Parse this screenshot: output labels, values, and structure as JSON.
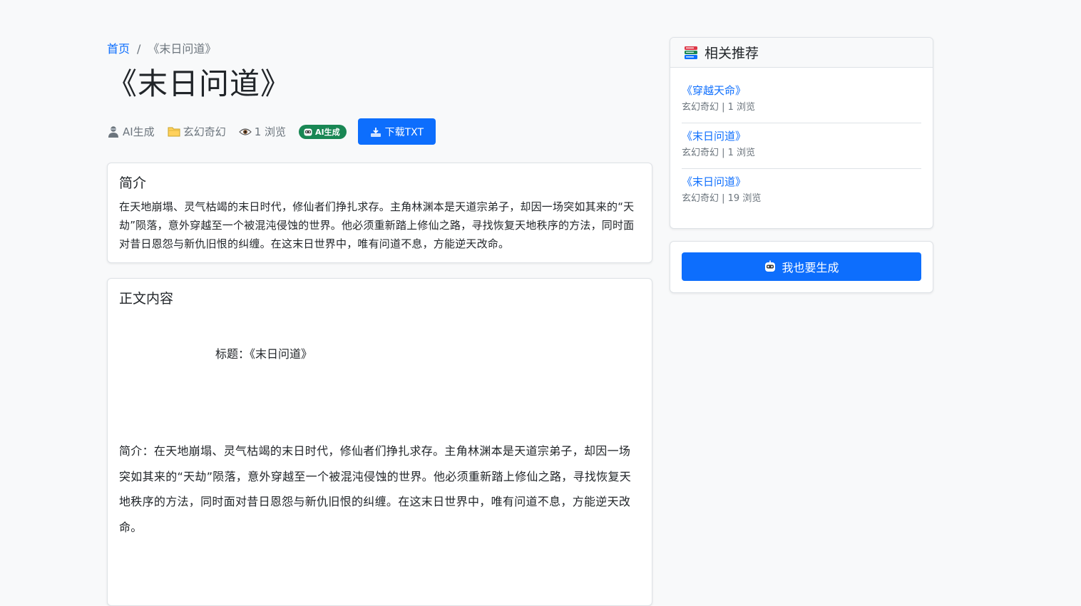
{
  "breadcrumb": {
    "home": "首页",
    "separator": "/",
    "current": "《末日问道》"
  },
  "title": "《末日问道》",
  "meta": {
    "author": "AI生成",
    "category": "玄幻奇幻",
    "views": "1 浏览",
    "badge": "AI生成",
    "download_label": "下载TXT"
  },
  "intro": {
    "heading": "简介",
    "text": "在天地崩塌、灵气枯竭的末日时代，修仙者们挣扎求存。主角林渊本是天道宗弟子，却因一场突如其来的“天劫”陨落，意外穿越至一个被混沌侵蚀的世界。他必须重新踏上修仙之路，寻找恢复天地秩序的方法，同时面对昔日恩怨与新仇旧恨的纠缠。在这末日世界中，唯有问道不息，方能逆天改命。"
  },
  "body": {
    "heading": "正文内容",
    "title_line": "标题：《末日问道》",
    "intro_line": "简介：在天地崩塌、灵气枯竭的末日时代，修仙者们挣扎求存。主角林渊本是天道宗弟子，却因一场突如其来的“天劫”陨落，意外穿越至一个被混沌侵蚀的世界。他必须重新踏上修仙之路，寻找恢复天地秩序的方法，同时面对昔日恩怨与新仇旧恨的纠缠。在这末日世界中，唯有问道不息，方能逆天改命。"
  },
  "recommend": {
    "heading": "相关推荐",
    "items": [
      {
        "name": "《穿越天命》",
        "info": "玄幻奇幻 | 1 浏览"
      },
      {
        "name": "《末日问道》",
        "info": "玄幻奇幻 | 1 浏览"
      },
      {
        "name": "《末日问道》",
        "info": "玄幻奇幻 | 19 浏览"
      }
    ]
  },
  "generate": {
    "label": "我也要生成"
  },
  "colors": {
    "primary": "#0d6efd",
    "success": "#198754",
    "muted": "#6c757d",
    "background": "#f8f9fa"
  },
  "icons": {
    "author": "user-icon",
    "category": "folder-icon",
    "views": "eye-icon",
    "badge": "robot-icon",
    "download": "download-tray-icon",
    "recommend": "books-icon",
    "generate": "robot-icon"
  }
}
